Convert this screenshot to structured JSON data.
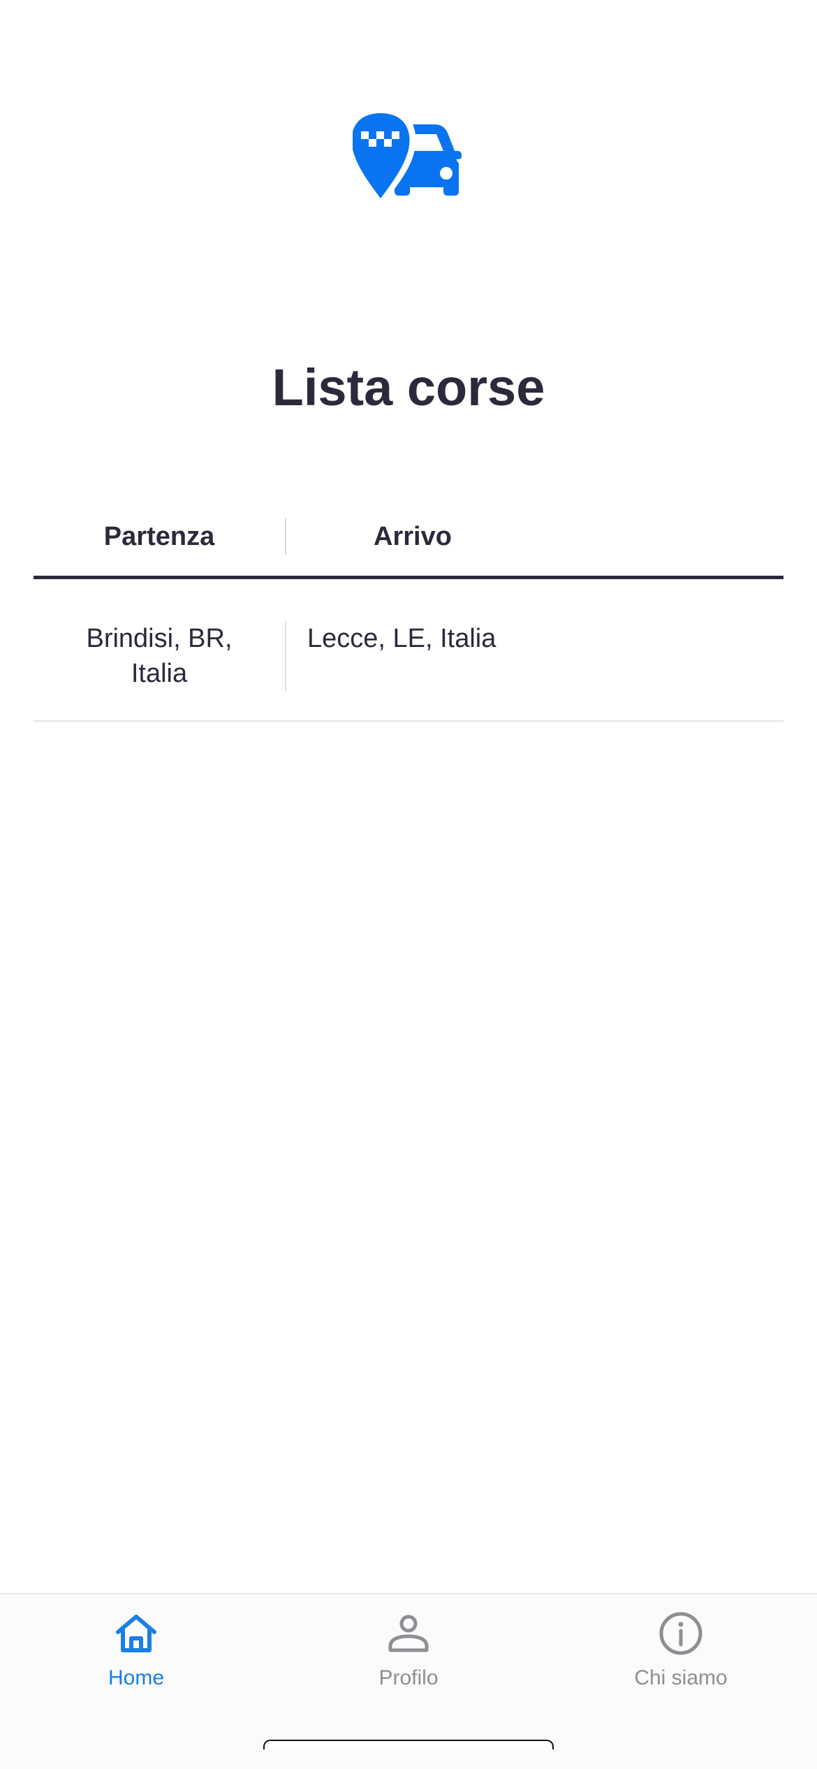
{
  "colors": {
    "accent": "#1a7fe6",
    "logo_blue": "#0a74f0",
    "text": "#2a2a3c",
    "inactive": "#8e8e93"
  },
  "logo": {
    "icon": "taxi-location-pin-car-icon"
  },
  "page": {
    "title": "Lista corse"
  },
  "table": {
    "headers": [
      "Partenza",
      "Arrivo"
    ],
    "rows": [
      {
        "partenza": "Brindisi, BR, Italia",
        "arrivo": "Lecce, LE, Italia"
      }
    ]
  },
  "tabbar": {
    "items": [
      {
        "label": "Home",
        "icon": "home-icon",
        "active": true
      },
      {
        "label": "Profilo",
        "icon": "person-icon",
        "active": false
      },
      {
        "label": "Chi siamo",
        "icon": "info-icon",
        "active": false
      }
    ]
  }
}
